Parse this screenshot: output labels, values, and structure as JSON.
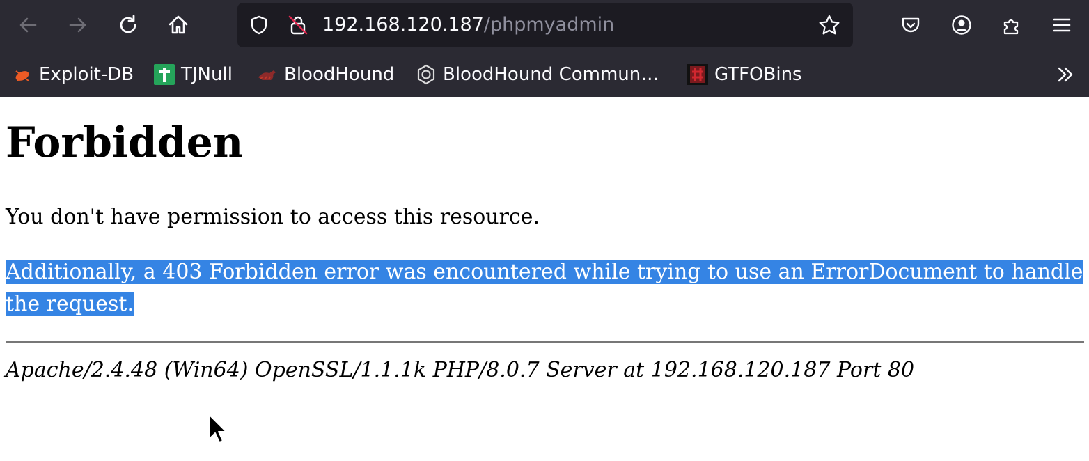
{
  "browser": {
    "address": {
      "host": "192.168.120.187",
      "path": "/phpmyadmin"
    },
    "bookmarks": [
      {
        "label": "Exploit-DB",
        "icon": "exploit-db-bug-icon",
        "color": "#ec5b25"
      },
      {
        "label": "TJNull",
        "icon": "tjnull-cross-icon",
        "color": "#25a45a"
      },
      {
        "label": "BloodHound",
        "icon": "bloodhound-icon",
        "color": "#c0392b"
      },
      {
        "label": "BloodHound Commun…",
        "icon": "bloodhound-community-icon",
        "color": "#dcdcdc"
      },
      {
        "label": "GTFOBins",
        "icon": "gtfobins-icon",
        "color": "#d1272f"
      }
    ],
    "overflow_icon": "chevron-double-right-icon"
  },
  "page": {
    "title": "Forbidden",
    "message": "You don't have permission to access this resource.",
    "additional": "Additionally, a 403 Forbidden error was encountered while trying to use an ErrorDocument to handle the request.",
    "server_signature": "Apache/2.4.48 (Win64) OpenSSL/1.1.1k PHP/8.0.7 Server at 192.168.120.187 Port 80"
  },
  "colors": {
    "chrome": "#2b2a33",
    "urlbar": "#1c1b22",
    "selection": "#3584e4"
  }
}
